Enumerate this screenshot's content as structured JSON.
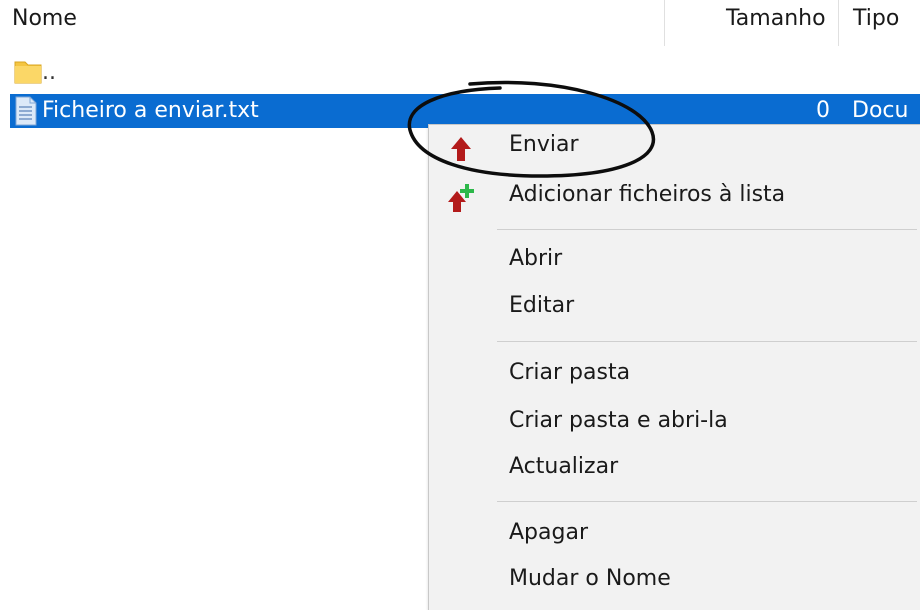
{
  "header": {
    "col_name": "Nome",
    "col_size": "Tamanho",
    "col_type": "Tipo"
  },
  "rows": [
    {
      "name": "..",
      "icon": "folder-icon"
    },
    {
      "name": "Ficheiro a enviar.txt",
      "size": "0",
      "type": "Docu",
      "icon": "document-icon",
      "selected": true
    }
  ],
  "menu": {
    "items": [
      {
        "label": "Enviar",
        "icon": "upload-arrow-icon"
      },
      {
        "label": "Adicionar ficheiros à lista",
        "icon": "add-to-list-icon"
      },
      {
        "label": "Abrir"
      },
      {
        "label": "Editar"
      },
      {
        "label": "Criar pasta"
      },
      {
        "label": "Criar pasta e abri-la"
      },
      {
        "label": "Actualizar"
      },
      {
        "label": "Apagar"
      },
      {
        "label": "Mudar o Nome"
      }
    ]
  },
  "colors": {
    "selection": "#0a6cd1",
    "menu_bg": "#f2f2f2",
    "upload_arrow": "#b31b1b",
    "add_plus": "#2db84a"
  }
}
